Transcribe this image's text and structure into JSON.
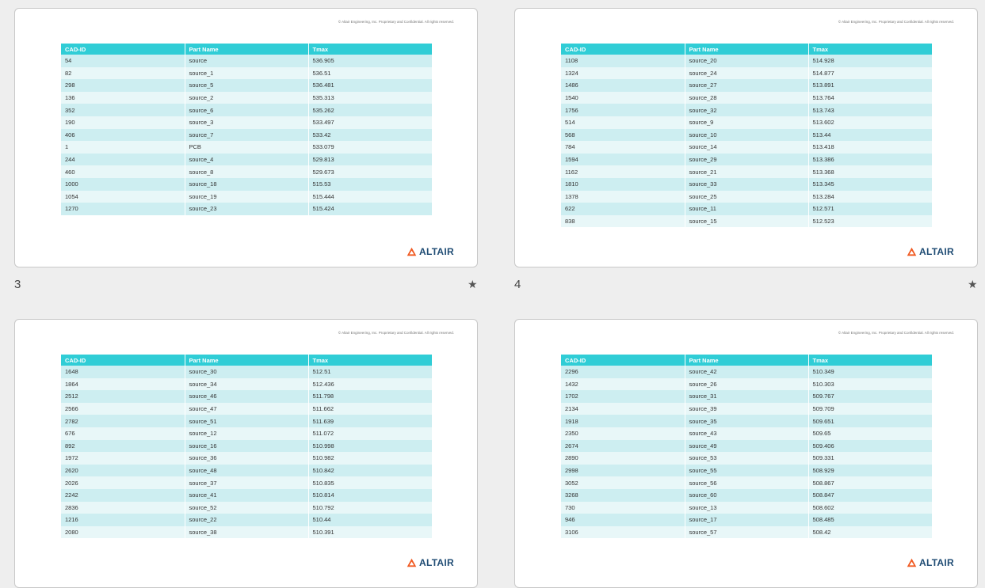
{
  "copyright": "© Altair Engineering, Inc. Proprietary and Confidential. All rights reserved.",
  "logo_text": "ALTAIR",
  "headers": [
    "CAD-ID",
    "Part Name",
    "Tmax"
  ],
  "slide_numbers": {
    "first": "3",
    "second": "4"
  },
  "star_glyph": "★",
  "colors": {
    "header_bg": "#30cdd6",
    "row_dark": "#cdeef1",
    "row_light": "#e8f7f8",
    "logo_orange": "#f05a22",
    "logo_navy": "#1e4b73"
  },
  "slides": [
    {
      "rows": [
        [
          "54",
          "source",
          "536.905"
        ],
        [
          "82",
          "source_1",
          "536.51"
        ],
        [
          "298",
          "source_5",
          "536.481"
        ],
        [
          "136",
          "source_2",
          "535.313"
        ],
        [
          "352",
          "source_6",
          "535.262"
        ],
        [
          "190",
          "source_3",
          "533.497"
        ],
        [
          "406",
          "source_7",
          "533.42"
        ],
        [
          "1",
          "PCB",
          "533.079"
        ],
        [
          "244",
          "source_4",
          "529.813"
        ],
        [
          "460",
          "source_8",
          "529.673"
        ],
        [
          "1000",
          "source_18",
          "515.53"
        ],
        [
          "1054",
          "source_19",
          "515.444"
        ],
        [
          "1270",
          "source_23",
          "515.424"
        ]
      ]
    },
    {
      "rows": [
        [
          "1108",
          "source_20",
          "514.928"
        ],
        [
          "1324",
          "source_24",
          "514.877"
        ],
        [
          "1486",
          "source_27",
          "513.891"
        ],
        [
          "1540",
          "source_28",
          "513.764"
        ],
        [
          "1756",
          "source_32",
          "513.743"
        ],
        [
          "514",
          "source_9",
          "513.602"
        ],
        [
          "568",
          "source_10",
          "513.44"
        ],
        [
          "784",
          "source_14",
          "513.418"
        ],
        [
          "1594",
          "source_29",
          "513.386"
        ],
        [
          "1162",
          "source_21",
          "513.368"
        ],
        [
          "1810",
          "source_33",
          "513.345"
        ],
        [
          "1378",
          "source_25",
          "513.284"
        ],
        [
          "622",
          "source_11",
          "512.571"
        ],
        [
          "838",
          "source_15",
          "512.523"
        ]
      ]
    },
    {
      "rows": [
        [
          "1648",
          "source_30",
          "512.51"
        ],
        [
          "1864",
          "source_34",
          "512.436"
        ],
        [
          "2512",
          "source_46",
          "511.798"
        ],
        [
          "2566",
          "source_47",
          "511.662"
        ],
        [
          "2782",
          "source_51",
          "511.639"
        ],
        [
          "676",
          "source_12",
          "511.072"
        ],
        [
          "892",
          "source_16",
          "510.998"
        ],
        [
          "1972",
          "source_36",
          "510.982"
        ],
        [
          "2620",
          "source_48",
          "510.842"
        ],
        [
          "2026",
          "source_37",
          "510.835"
        ],
        [
          "2242",
          "source_41",
          "510.814"
        ],
        [
          "2836",
          "source_52",
          "510.792"
        ],
        [
          "1216",
          "source_22",
          "510.44"
        ],
        [
          "2080",
          "source_38",
          "510.391"
        ]
      ]
    },
    {
      "rows": [
        [
          "2296",
          "source_42",
          "510.349"
        ],
        [
          "1432",
          "source_26",
          "510.303"
        ],
        [
          "1702",
          "source_31",
          "509.767"
        ],
        [
          "2134",
          "source_39",
          "509.709"
        ],
        [
          "1918",
          "source_35",
          "509.651"
        ],
        [
          "2350",
          "source_43",
          "509.65"
        ],
        [
          "2674",
          "source_49",
          "509.406"
        ],
        [
          "2890",
          "source_53",
          "509.331"
        ],
        [
          "2998",
          "source_55",
          "508.929"
        ],
        [
          "3052",
          "source_56",
          "508.867"
        ],
        [
          "3268",
          "source_60",
          "508.847"
        ],
        [
          "730",
          "source_13",
          "508.602"
        ],
        [
          "946",
          "source_17",
          "508.485"
        ],
        [
          "3106",
          "source_57",
          "508.42"
        ]
      ]
    }
  ]
}
